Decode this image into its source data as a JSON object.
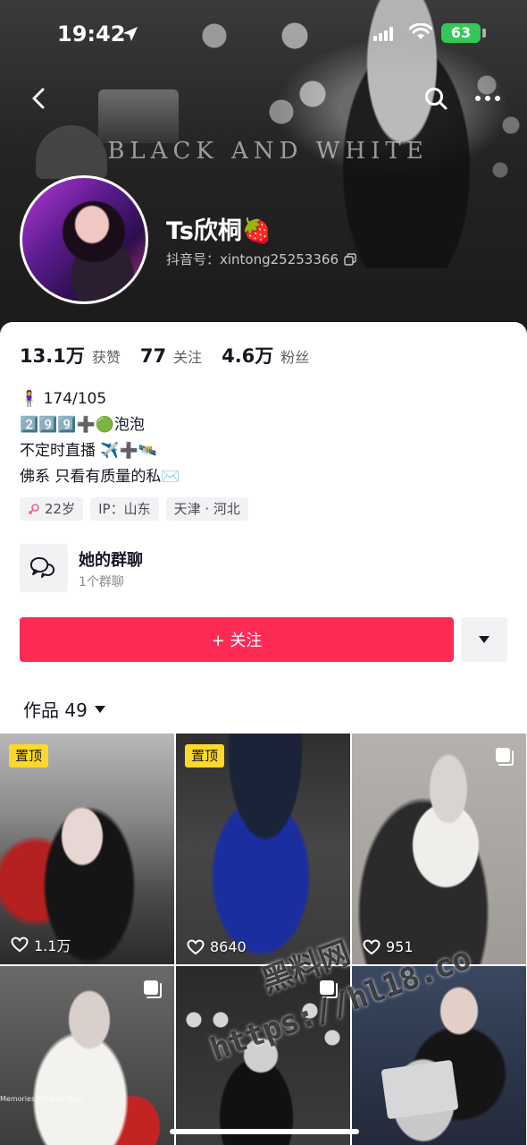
{
  "status_bar": {
    "time": "19:42",
    "battery": "63"
  },
  "cover": {
    "overlay_text": "BLACK AND WHITE"
  },
  "profile": {
    "name": "Ts欣桐🍓",
    "douyin_id": "抖音号：xintong25253366"
  },
  "stats": [
    {
      "value": "13.1万",
      "label": "获赞"
    },
    {
      "value": "77",
      "label": "关注"
    },
    {
      "value": "4.6万",
      "label": "粉丝"
    }
  ],
  "bio": [
    "🧍‍♀️ 174/105",
    "2️⃣9️⃣9️⃣➕🟢泡泡",
    "不定时直播 ✈️➕🛰️",
    "佛系 只看有质量的私✉️"
  ],
  "tags": [
    {
      "text": "22岁",
      "icon": "female-icon"
    },
    {
      "text": "IP：山东"
    },
    {
      "text": "天津 · 河北"
    }
  ],
  "group_chat": {
    "title": "她的群聊",
    "subtitle": "1个群聊"
  },
  "actions": {
    "follow": "+ 关注"
  },
  "works_tab": {
    "label": "作品 49"
  },
  "grid": [
    {
      "pinned": "置顶",
      "likes": "1.1万"
    },
    {
      "pinned": "置顶",
      "likes": "8640"
    },
    {
      "likes": "951",
      "icon": "multi-image-icon"
    },
    {
      "caption": "Memories of rainy days",
      "icon": "multi-image-icon"
    },
    {
      "icon": "multi-image-icon"
    },
    {}
  ],
  "watermark": {
    "cn": "黑料网",
    "url": "https://hl18.co"
  },
  "colors": {
    "follow": "#fe2c55",
    "pin": "#fdd82c",
    "battery": "#33c759"
  }
}
